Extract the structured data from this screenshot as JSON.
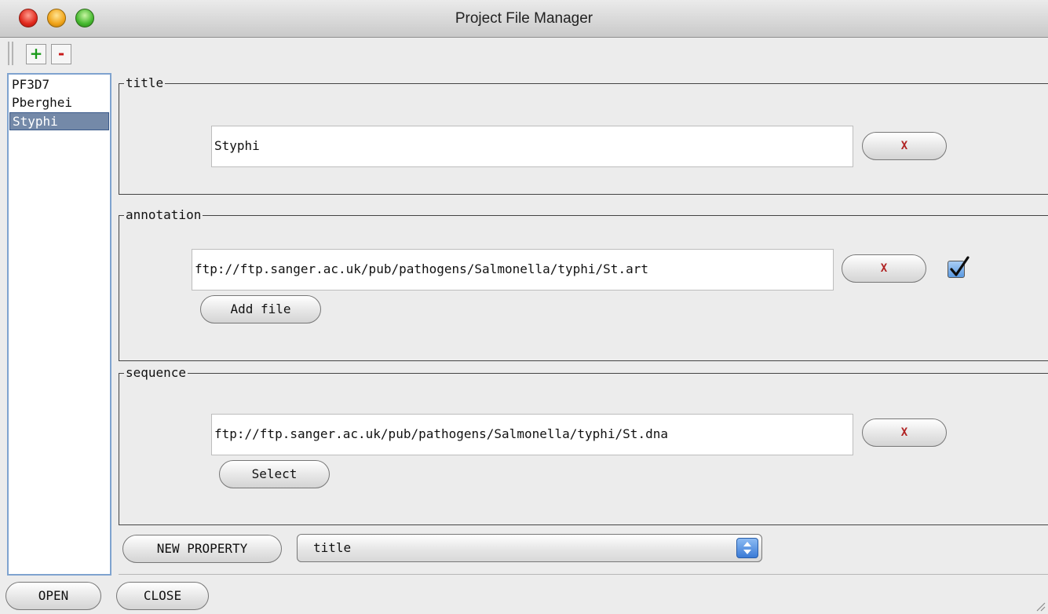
{
  "window": {
    "title": "Project File Manager"
  },
  "toolbar": {
    "add_label": "+",
    "remove_label": "-"
  },
  "projects": {
    "items": [
      {
        "label": "PF3D7"
      },
      {
        "label": "Pberghei"
      },
      {
        "label": "Styphi"
      }
    ],
    "selected": "Styphi"
  },
  "properties": {
    "title": {
      "legend": "title",
      "value": "Styphi",
      "delete_label": "X"
    },
    "annotation": {
      "legend": "annotation",
      "value": "ftp://ftp.sanger.ac.uk/pub/pathogens/Salmonella/typhi/St.art",
      "delete_label": "X",
      "checked": true,
      "add_label": "Add file"
    },
    "sequence": {
      "legend": "sequence",
      "value": "ftp://ftp.sanger.ac.uk/pub/pathogens/Salmonella/typhi/St.dna",
      "delete_label": "X",
      "select_label": "Select"
    }
  },
  "new_property": {
    "button_label": "NEW PROPERTY",
    "selected_option": "title"
  },
  "footer": {
    "open_label": "OPEN",
    "close_label": "CLOSE"
  },
  "colors": {
    "selection": "#7489a8",
    "list_border": "#7fa3cf",
    "delete_text": "#b02222"
  }
}
